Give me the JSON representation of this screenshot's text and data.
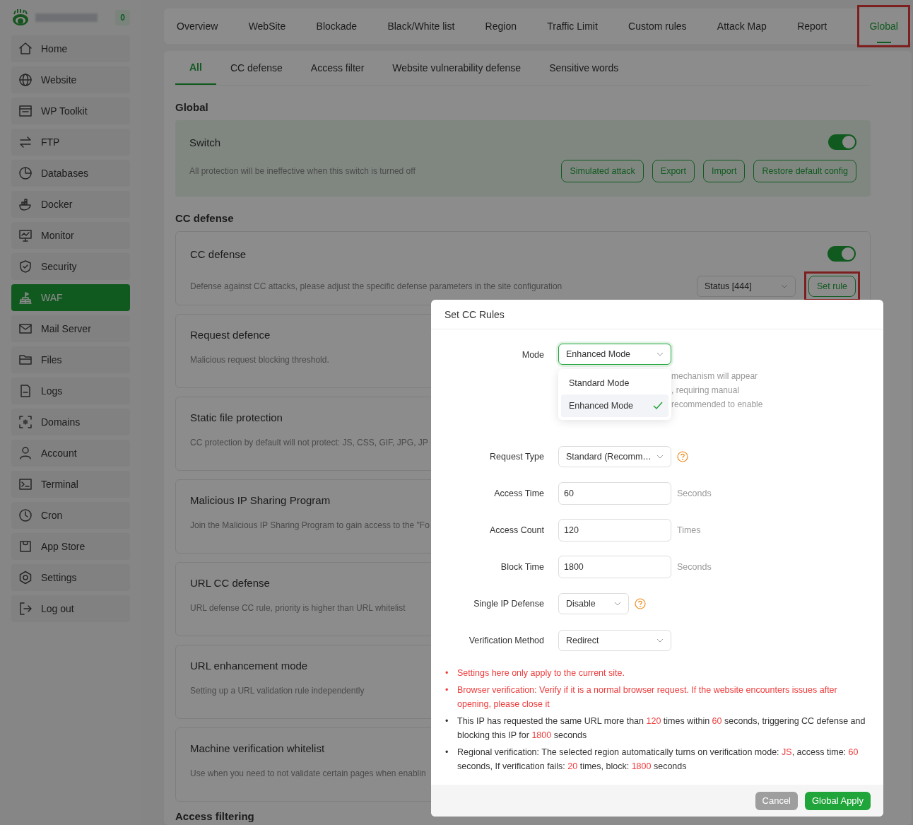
{
  "sidebar": {
    "badge": "0",
    "items": [
      {
        "label": "Home",
        "selected": false
      },
      {
        "label": "Website",
        "selected": false
      },
      {
        "label": "WP Toolkit",
        "selected": false
      },
      {
        "label": "FTP",
        "selected": false
      },
      {
        "label": "Databases",
        "selected": false
      },
      {
        "label": "Docker",
        "selected": false
      },
      {
        "label": "Monitor",
        "selected": false
      },
      {
        "label": "Security",
        "selected": false
      },
      {
        "label": "WAF",
        "selected": true
      },
      {
        "label": "Mail Server",
        "selected": false
      },
      {
        "label": "Files",
        "selected": false
      },
      {
        "label": "Logs",
        "selected": false
      },
      {
        "label": "Domains",
        "selected": false
      },
      {
        "label": "Account",
        "selected": false
      },
      {
        "label": "Terminal",
        "selected": false
      },
      {
        "label": "Cron",
        "selected": false
      },
      {
        "label": "App Store",
        "selected": false
      },
      {
        "label": "Settings",
        "selected": false
      },
      {
        "label": "Log out",
        "selected": false
      }
    ]
  },
  "top_tabs": [
    {
      "label": "Overview",
      "selected": false,
      "highlighted": false
    },
    {
      "label": "WebSite",
      "selected": false,
      "highlighted": false
    },
    {
      "label": "Blockade",
      "selected": false,
      "highlighted": false
    },
    {
      "label": "Black/White list",
      "selected": false,
      "highlighted": false
    },
    {
      "label": "Region",
      "selected": false,
      "highlighted": false
    },
    {
      "label": "Traffic Limit",
      "selected": false,
      "highlighted": false
    },
    {
      "label": "Custom rules",
      "selected": false,
      "highlighted": false
    },
    {
      "label": "Attack Map",
      "selected": false,
      "highlighted": false
    },
    {
      "label": "Report",
      "selected": false,
      "highlighted": false
    },
    {
      "label": "Global",
      "selected": true,
      "highlighted": true
    }
  ],
  "sub_tabs": [
    {
      "label": "All",
      "selected": true
    },
    {
      "label": "CC defense",
      "selected": false
    },
    {
      "label": "Access filter",
      "selected": false
    },
    {
      "label": "Website vulnerability defense",
      "selected": false
    },
    {
      "label": "Sensitive words",
      "selected": false
    }
  ],
  "global": {
    "heading": "Global",
    "title": "Switch",
    "on": true,
    "description": "All protection will be ineffective when this switch is turned off",
    "buttons": [
      "Simulated attack",
      "Export",
      "Import",
      "Restore default config"
    ]
  },
  "cc_section": {
    "heading": "CC defense",
    "cards": [
      {
        "title": "CC defense",
        "description": "Defense against CC attacks, please adjust the specific defense parameters in the site configuration",
        "on": true,
        "select": "Status [444]",
        "button": "Set rule",
        "button_highlighted": true
      },
      {
        "title": "Request defence",
        "description": "Malicious request blocking threshold."
      },
      {
        "title": "Static file protection",
        "description": "CC protection by default will not protect: JS, CSS, GIF, JPG, JP"
      },
      {
        "title": "Malicious IP Sharing Program",
        "description": "Join the Malicious IP Sharing Program to gain access to the \"Fo"
      },
      {
        "title": "URL CC defense",
        "description": "URL defense CC rule, priority is higher than URL whitelist"
      },
      {
        "title": "URL enhancement mode",
        "description": "Setting up a URL validation rule independently"
      },
      {
        "title": "Machine verification whitelist",
        "description": "Use when you need to not validate certain pages when enablin"
      }
    ]
  },
  "next_heading": "Access filtering",
  "dialog": {
    "title": "Set CC Rules",
    "mode": {
      "label": "Mode",
      "value": "Enhanced Mode",
      "open": true,
      "options": [
        {
          "label": "Standard Mode",
          "selected": false
        },
        {
          "label": "Enhanced Mode",
          "selected": true
        }
      ],
      "hint_lines": [
        "mechanism will appear",
        ", requiring manual",
        "recommended to enable"
      ]
    },
    "fields": [
      {
        "kind": "select",
        "label": "Request Type",
        "value": "Standard (Recomm…",
        "help": true
      },
      {
        "kind": "input",
        "label": "Access Time",
        "value": "60",
        "unit": "Seconds"
      },
      {
        "kind": "input",
        "label": "Access Count",
        "value": "120",
        "unit": "Times"
      },
      {
        "kind": "input",
        "label": "Block Time",
        "value": "1800",
        "unit": "Seconds"
      },
      {
        "kind": "select-small",
        "label": "Single IP Defense",
        "value": "Disable",
        "help": true
      },
      {
        "kind": "select",
        "label": "Verification Method",
        "value": "Redirect"
      }
    ],
    "notes": [
      {
        "kind": "warning",
        "marker": "•",
        "text": "Settings here only apply to the current site."
      },
      {
        "kind": "warning",
        "marker": "•",
        "text": "Browser verification: Verify if it is a normal browser request. If the website encounters issues after opening, please close it"
      },
      {
        "kind": "info",
        "marker": "•",
        "parts": [
          {
            "text": "This IP has requested the same URL more than ",
            "highlight": false
          },
          {
            "text": "120",
            "highlight": true
          },
          {
            "text": " times within ",
            "highlight": false
          },
          {
            "text": "60",
            "highlight": true
          },
          {
            "text": " seconds, triggering CC defense and blocking this IP for ",
            "highlight": false
          },
          {
            "text": "1800",
            "highlight": true
          },
          {
            "text": " seconds",
            "highlight": false
          }
        ]
      },
      {
        "kind": "info",
        "marker": "•",
        "parts": [
          {
            "text": "Regional verification: The selected region automatically turns on verification mode: ",
            "highlight": false
          },
          {
            "text": "JS",
            "highlight": true
          },
          {
            "text": ", access time: ",
            "highlight": false
          },
          {
            "text": "60",
            "highlight": true
          },
          {
            "text": " seconds, If verification fails: ",
            "highlight": false
          },
          {
            "text": "20",
            "highlight": true
          },
          {
            "text": " times, block: ",
            "highlight": false
          },
          {
            "text": "1800",
            "highlight": true
          },
          {
            "text": " seconds",
            "highlight": false
          }
        ]
      }
    ],
    "cancel": {
      "label": "Cancel",
      "disabled": true
    },
    "apply": {
      "label": "Global Apply"
    }
  }
}
